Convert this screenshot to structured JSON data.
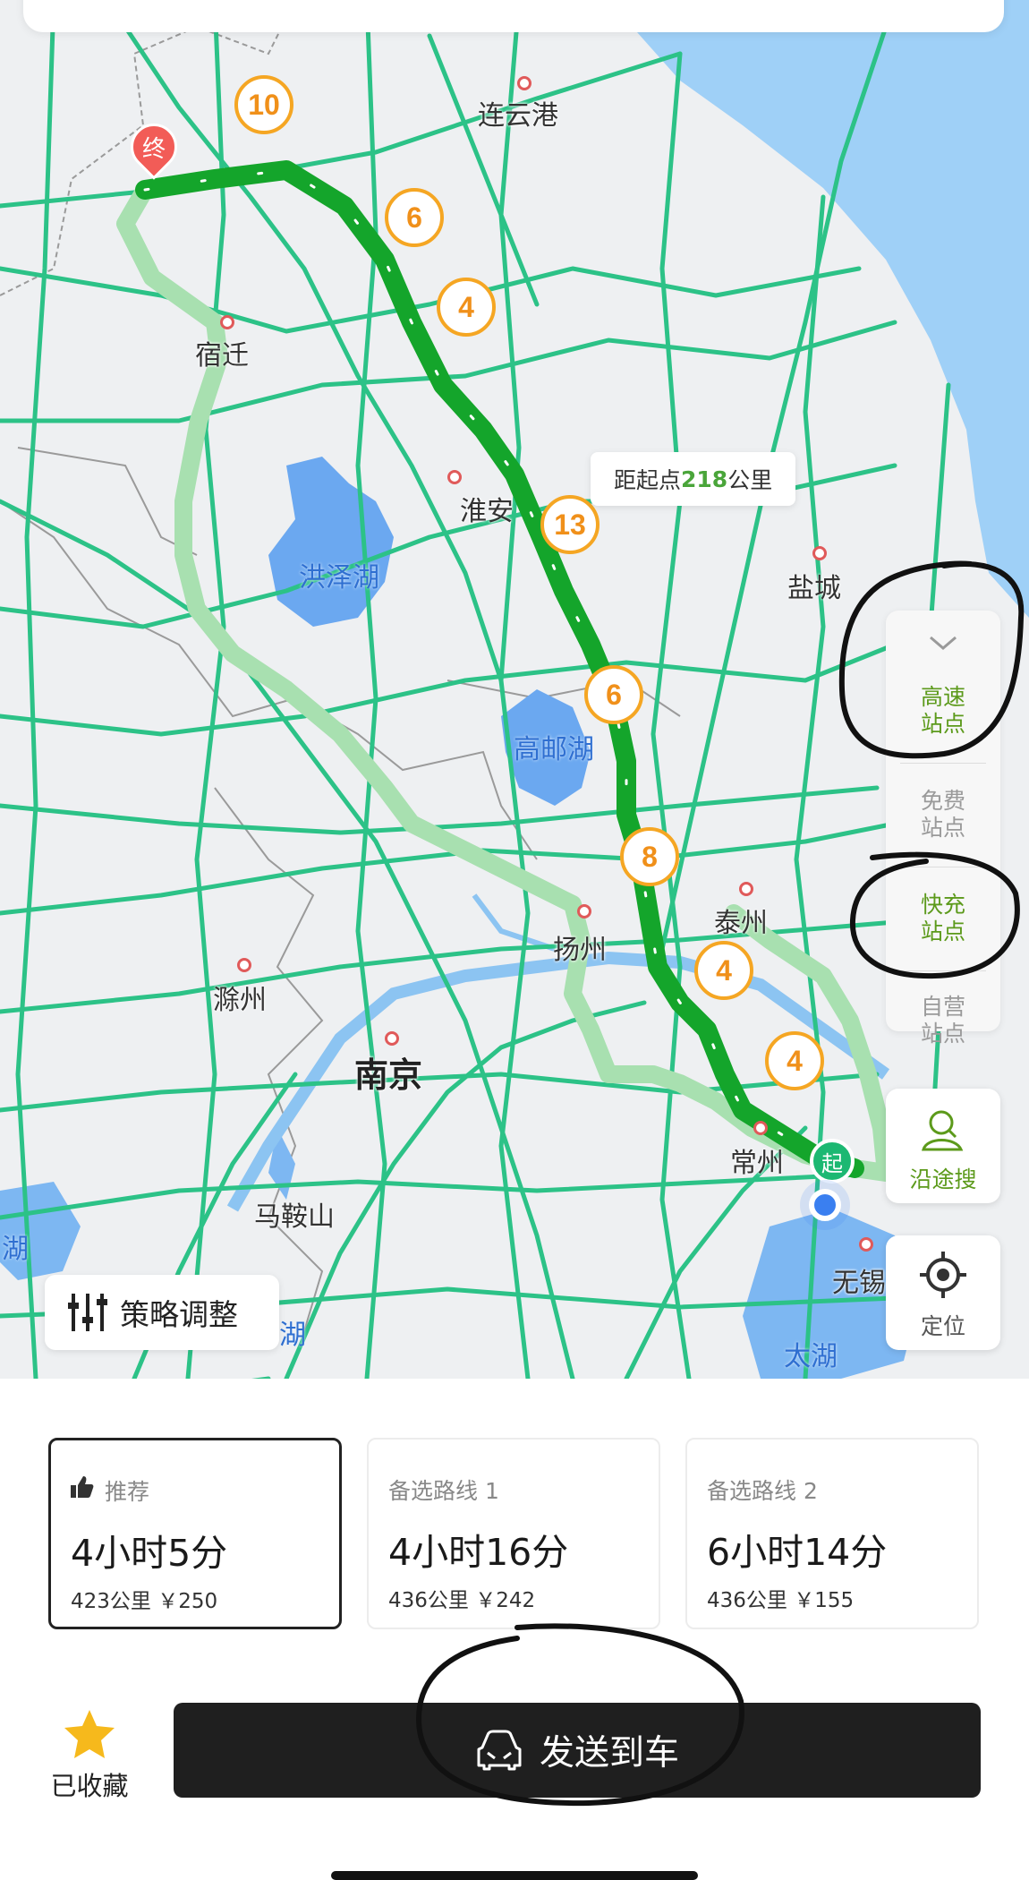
{
  "map": {
    "cities": [
      {
        "id": "lianyungang",
        "label": "连云港"
      },
      {
        "id": "suqian",
        "label": "宿迁"
      },
      {
        "id": "huaian",
        "label": "淮安"
      },
      {
        "id": "yancheng",
        "label": "盐城"
      },
      {
        "id": "taizhou",
        "label": "泰州"
      },
      {
        "id": "yangzhou",
        "label": "扬州"
      },
      {
        "id": "chuzhou",
        "label": "滁州"
      },
      {
        "id": "nanjing",
        "label": "南京"
      },
      {
        "id": "changzhou",
        "label": "常州"
      },
      {
        "id": "maanshan",
        "label": "马鞍山"
      },
      {
        "id": "wuxi",
        "label": "无锡"
      }
    ],
    "lakes": [
      {
        "id": "hongze",
        "label": "洪泽湖"
      },
      {
        "id": "gaoyou",
        "label": "高邮湖"
      },
      {
        "id": "taihu",
        "label": "太湖"
      },
      {
        "id": "west-hu",
        "label": "湖"
      },
      {
        "id": "south-hu",
        "label": "湖"
      }
    ],
    "charging_markers": [
      "10",
      "6",
      "4",
      "13",
      "6",
      "8",
      "4",
      "4"
    ],
    "distance_tip": {
      "prefix": "距起点",
      "value": "218",
      "suffix": "公里"
    },
    "end_pin_label": "终",
    "start_badge_label": "起",
    "route_colors": {
      "main": "#14a52b",
      "alt": "#a8e0b0",
      "road": "#2cc287"
    }
  },
  "side_panel": {
    "collapse_icon": "chevron-down-icon",
    "items": [
      {
        "label": "高速\n站点",
        "active": true
      },
      {
        "label": "免费\n站点",
        "active": false
      },
      {
        "label": "快充\n站点",
        "active": true
      },
      {
        "label": "自营\n站点",
        "active": false
      }
    ]
  },
  "along_search": {
    "label": "沿途搜",
    "icon": "person-search-icon"
  },
  "locate": {
    "label": "定位",
    "icon": "crosshair-icon"
  },
  "strategy": {
    "label": "策略调整",
    "icon": "sliders-icon"
  },
  "routes": [
    {
      "tag": "推荐",
      "time": "4小时5分",
      "meta": "423公里 ￥250",
      "selected": true
    },
    {
      "tag": "备选路线 1",
      "time": "4小时16分",
      "meta": "436公里 ￥242",
      "selected": false
    },
    {
      "tag": "备选路线 2",
      "time": "6小时14分",
      "meta": "436公里 ￥155",
      "selected": false
    }
  ],
  "favorite": {
    "label": "已收藏",
    "icon": "star-icon",
    "color": "#f6b91c"
  },
  "send": {
    "label": "发送到车",
    "icon": "car-icon"
  }
}
